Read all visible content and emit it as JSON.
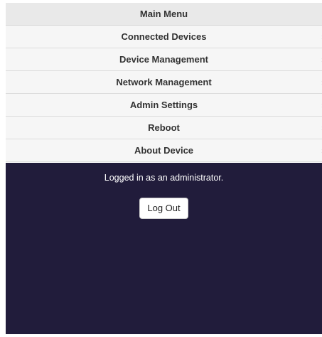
{
  "menu": {
    "title": "Main Menu",
    "items": [
      {
        "label": "Connected Devices",
        "icon": "chevron-right-icon"
      },
      {
        "label": "Device Management",
        "icon": "chevron-right-icon"
      },
      {
        "label": "Network Management",
        "icon": "chevron-right-icon"
      },
      {
        "label": "Admin Settings",
        "icon": "chevron-right-icon"
      },
      {
        "label": "Reboot",
        "icon": "chevron-right-icon"
      },
      {
        "label": "About Device",
        "icon": "chevron-right-icon"
      }
    ]
  },
  "account": {
    "status_text": "Logged in as an administrator.",
    "logout_label": "Log Out"
  },
  "colors": {
    "panel_background": "#211c3b",
    "menu_header_background": "#e9e9e9",
    "menu_item_background": "#f6f6f6"
  }
}
